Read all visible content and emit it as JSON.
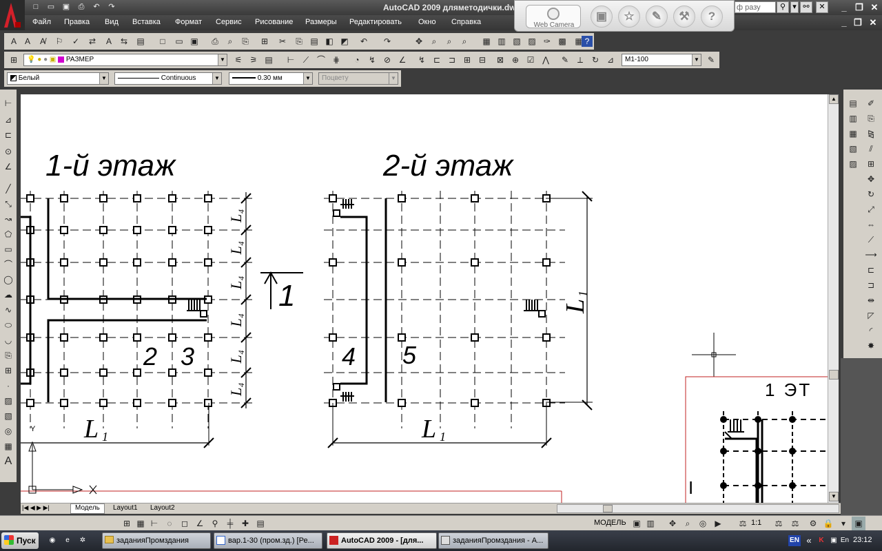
{
  "titlebar": {
    "title": "AutoCAD 2009 дляметодички.dwg",
    "search_placeholder": "ф разу",
    "quick_access": [
      "new-icon",
      "open-icon",
      "save-icon",
      "print-icon",
      "undo-icon",
      "redo-icon"
    ]
  },
  "menubar": {
    "items": [
      "Файл",
      "Правка",
      "Вид",
      "Вставка",
      "Формат",
      "Сервис",
      "Рисование",
      "Размеры",
      "Редактировать",
      "Окно",
      "Справка"
    ]
  },
  "webcam": {
    "label": "Web Camera"
  },
  "layer_toolbar": {
    "layer_name": "РАЗМЕР",
    "dimstyle": "М1-100"
  },
  "properties_toolbar": {
    "color": "Белый",
    "linetype": "Continuous",
    "lineweight": "0.30 мм",
    "plotstyle": "Поцвету"
  },
  "drawing": {
    "floor1_title": "1-й этаж",
    "floor2_title": "2-й этаж",
    "labels": [
      "2",
      "3",
      "4",
      "5"
    ],
    "section_label": "1",
    "dim_L1": "L",
    "dim_L1_sub": "1",
    "dim_L4": "L",
    "dim_L4_sub": "4",
    "inset_text": "1 ЭТ",
    "ucs_x": "X",
    "ucs_y": "Y"
  },
  "layout_tabs": [
    "Модель",
    "Layout1",
    "Layout2"
  ],
  "statusbar": {
    "model_label": "МОДЕЛЬ",
    "scale": "1:1"
  },
  "taskbar": {
    "start": "Пуск",
    "tasks": [
      "заданияПромздания",
      "вар.1-30 (пром.зд.) [Ре...",
      "AutoCAD 2009 - [для...",
      "заданияПромздания - А..."
    ],
    "lang": "EN",
    "clock": "23:12"
  }
}
